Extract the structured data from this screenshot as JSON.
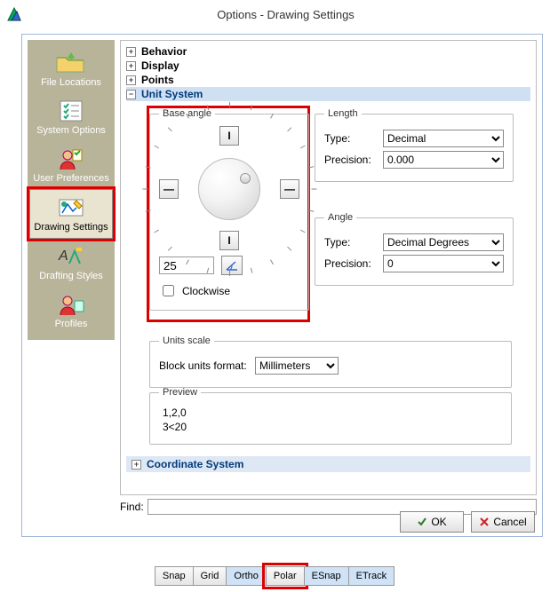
{
  "window": {
    "title": "Options - Drawing Settings"
  },
  "sidebar": {
    "items": [
      {
        "label": "File Locations",
        "selected": false
      },
      {
        "label": "System Options",
        "selected": false
      },
      {
        "label": "User Preferences",
        "selected": false
      },
      {
        "label": "Drawing Settings",
        "selected": true
      },
      {
        "label": "Drafting Styles",
        "selected": false
      },
      {
        "label": "Profiles",
        "selected": false
      }
    ]
  },
  "tree": {
    "behavior": "Behavior",
    "display": "Display",
    "points": "Points",
    "unit_system": "Unit System",
    "coord": "Coordinate System"
  },
  "base_angle": {
    "legend": "Base angle",
    "value": "25",
    "clockwise_label": "Clockwise",
    "clockwise_checked": false
  },
  "length": {
    "legend": "Length",
    "type_label": "Type:",
    "type_value": "Decimal",
    "precision_label": "Precision:",
    "precision_value": "0.000"
  },
  "angle": {
    "legend": "Angle",
    "type_label": "Type:",
    "type_value": "Decimal Degrees",
    "precision_label": "Precision:",
    "precision_value": "0"
  },
  "units_scale": {
    "legend": "Units scale",
    "label": "Block units format:",
    "value": "Millimeters"
  },
  "preview": {
    "legend": "Preview",
    "line1": "1,2,0",
    "line2": "3<20"
  },
  "find": {
    "label": "Find:",
    "value": ""
  },
  "buttons": {
    "ok": "OK",
    "cancel": "Cancel"
  },
  "statusbar": {
    "items": [
      {
        "label": "Snap",
        "active": false
      },
      {
        "label": "Grid",
        "active": false
      },
      {
        "label": "Ortho",
        "active": true
      },
      {
        "label": "Polar",
        "active": false,
        "highlight": true
      },
      {
        "label": "ESnap",
        "active": true
      },
      {
        "label": "ETrack",
        "active": true
      }
    ]
  }
}
